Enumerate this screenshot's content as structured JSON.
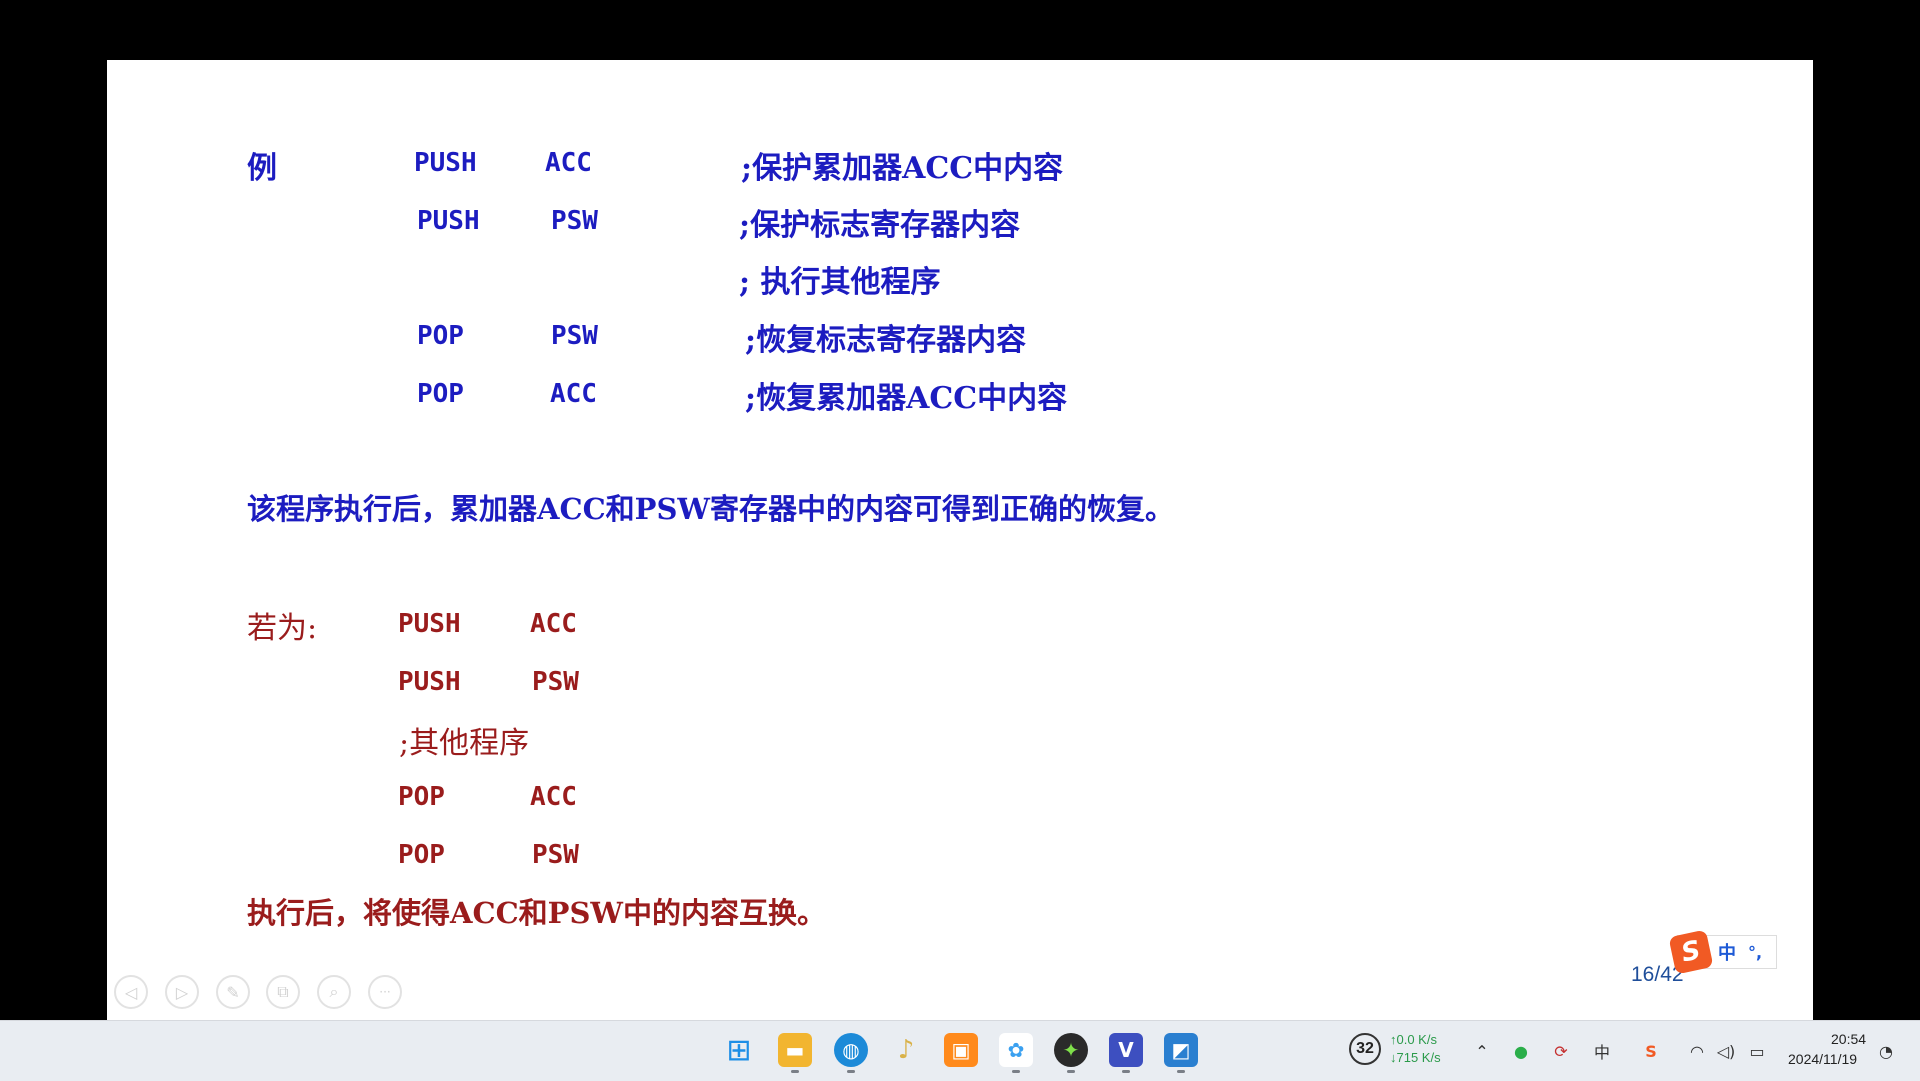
{
  "slide": {
    "example": {
      "label": "例",
      "rows": [
        {
          "op": "PUSH",
          "arg": "ACC",
          "comment": ";保护累加器ACC中内容"
        },
        {
          "op": "PUSH",
          "arg": "PSW",
          "comment": ";保护标志寄存器内容"
        },
        {
          "op": "",
          "arg": "",
          "comment": ";  执行其他程序"
        },
        {
          "op": "POP",
          "arg": "PSW",
          "comment": ";恢复标志寄存器内容"
        },
        {
          "op": "POP",
          "arg": "ACC",
          "comment": ";恢复累加器ACC中内容"
        }
      ],
      "conclusion": "该程序执行后，累加器ACC和PSW寄存器中的内容可得到正确的恢复。"
    },
    "alternative": {
      "label": "若为:",
      "rows": [
        {
          "op": "PUSH",
          "arg": "ACC"
        },
        {
          "op": "PUSH",
          "arg": "PSW"
        },
        {
          "comment": ";其他程序"
        },
        {
          "op": "POP",
          "arg": "ACC"
        },
        {
          "op": "POP",
          "arg": "PSW"
        }
      ],
      "conclusion": "执行后，将使得ACC和PSW中的内容互换。"
    },
    "page_number": "16/42",
    "ime": {
      "logo": "S",
      "mode": "中",
      "punct": "°,"
    }
  },
  "nav_controls": [
    {
      "name": "prev-slide-icon",
      "glyph": "◁"
    },
    {
      "name": "next-slide-icon",
      "glyph": "▷"
    },
    {
      "name": "pen-icon",
      "glyph": "✎"
    },
    {
      "name": "slides-overview-icon",
      "glyph": "⧉"
    },
    {
      "name": "zoom-icon",
      "glyph": "⌕"
    },
    {
      "name": "more-icon",
      "glyph": "···"
    }
  ],
  "taskbar": {
    "apps": [
      {
        "name": "windows-start-icon",
        "glyph": "⊞",
        "color": "#1d8ee6"
      },
      {
        "name": "file-explorer-icon",
        "glyph": "▬",
        "color": "#f2b530"
      },
      {
        "name": "edge-browser-icon",
        "glyph": "◍",
        "color": "#1c8ad8"
      },
      {
        "name": "app-icon-yellow",
        "glyph": "♪",
        "color": "#d9b24a"
      },
      {
        "name": "app-icon-windows",
        "glyph": "▣",
        "color": "#2d8fe0"
      },
      {
        "name": "app-icon-cloud",
        "glyph": "✿",
        "color": "#3aa0f0"
      },
      {
        "name": "app-icon-green",
        "glyph": "✦",
        "color": "#2a2a2a"
      },
      {
        "name": "app-icon-vs",
        "glyph": "V",
        "color": "#3d4fc0"
      },
      {
        "name": "photos-icon",
        "glyph": "◩",
        "color": "#2a7fd0"
      }
    ],
    "tray": {
      "badge": "32",
      "upload": "↑0.0 K/s",
      "download": "↓715 K/s",
      "time": "20:54",
      "date": "2024/11/19"
    }
  }
}
